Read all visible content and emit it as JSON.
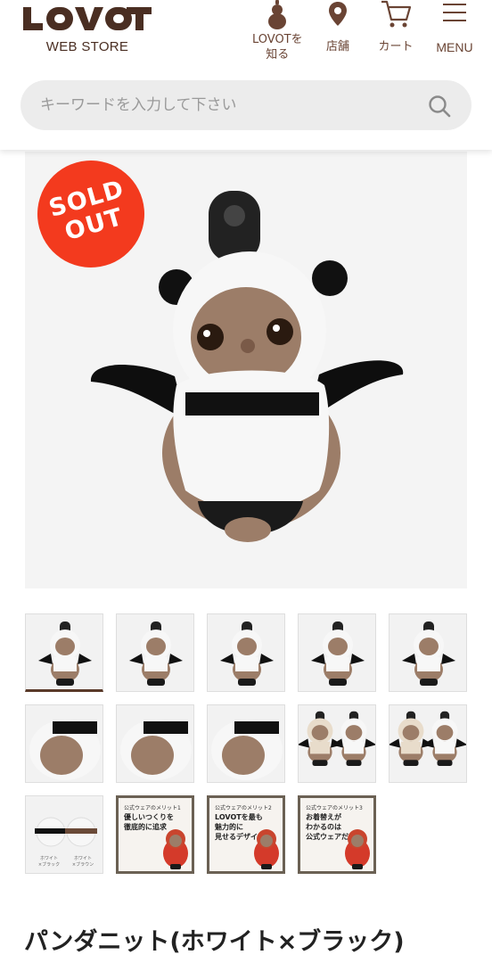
{
  "header": {
    "logo_text": "LOVOT",
    "logo_sub": "WEB STORE",
    "nav": [
      {
        "label": "LOVOTを\n知る",
        "icon": "gourd-icon"
      },
      {
        "label": "店舗",
        "icon": "location-pin-icon"
      },
      {
        "label": "カート",
        "icon": "cart-icon"
      },
      {
        "label": "MENU",
        "icon": "hamburger-icon"
      }
    ]
  },
  "search": {
    "placeholder": "キーワードを入力して下さい",
    "icon": "search-icon"
  },
  "product": {
    "badge_line1": "SOLD",
    "badge_line2": "OUT",
    "title": "パンダニット(ホワイト×ブラック)"
  },
  "thumbnails": [
    {
      "kind": "photo",
      "variant": "front",
      "selected": true
    },
    {
      "kind": "photo",
      "variant": "front-left"
    },
    {
      "kind": "photo",
      "variant": "front-right"
    },
    {
      "kind": "photo",
      "variant": "side"
    },
    {
      "kind": "photo",
      "variant": "back"
    },
    {
      "kind": "photo",
      "variant": "head-closeup"
    },
    {
      "kind": "photo",
      "variant": "arm-closeup"
    },
    {
      "kind": "photo",
      "variant": "tail-closeup"
    },
    {
      "kind": "photo",
      "variant": "pair-with-bear"
    },
    {
      "kind": "photo",
      "variant": "pair-with-bear-2"
    },
    {
      "kind": "swatch",
      "caption_left": "ホワイト\n×ブラック",
      "caption_right": "ホワイト\n×ブラウン"
    },
    {
      "kind": "info",
      "tag": "公式ウェアのメリット1",
      "headline": "優しいつくりを\n徹底的に追求"
    },
    {
      "kind": "info",
      "tag": "公式ウェアのメリット2",
      "headline": "LOVOTを最も\n魅力的に\n見せるデザイン"
    },
    {
      "kind": "info",
      "tag": "公式ウェアのメリット3",
      "headline": "お着替えが\nわかるのは\n公式ウェアだけ"
    }
  ],
  "colors": {
    "brand": "#4a2e22",
    "sold_out": "#f33a1e",
    "search_bg": "#ececec"
  }
}
